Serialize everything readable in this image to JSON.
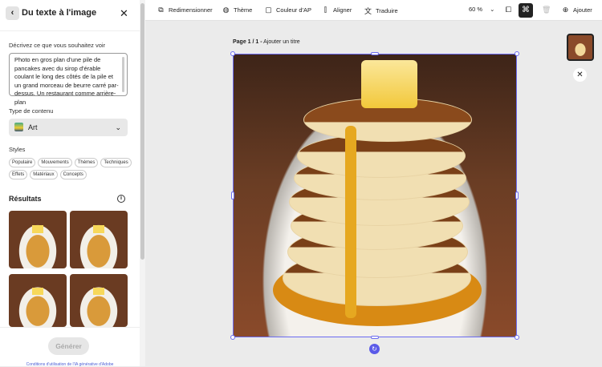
{
  "panel": {
    "title": "Du texte à l'image",
    "prompt_label": "Décrivez ce que vous souhaitez voir",
    "prompt_value": "Photo en gros plan d'une pile de pancakes avec du sirop d'érable coulant le long des côtés de la pile et un grand morceau de beurre carré par-dessus. Un restaurant comme arrière-plan",
    "content_type_label": "Type de contenu",
    "content_type_value": "Art",
    "styles_label": "Styles",
    "styles": [
      "Populaire",
      "Mouvements",
      "Thèmes",
      "Techniques",
      "Effets",
      "Matériaux",
      "Concepts"
    ],
    "results_label": "Résultats",
    "generate_label": "Générer",
    "terms_link": "Conditions d'utilisation de l'IA générative d'Adobe"
  },
  "toolbar": {
    "resize": "Redimensionner",
    "theme": "Thème",
    "bg_color": "Couleur d'AP",
    "align": "Aligner",
    "translate": "Traduire",
    "zoom": "60 %",
    "add": "Ajouter"
  },
  "canvas": {
    "page_label": "Page 1 / 1 -",
    "page_title_placeholder": "Ajouter un titre"
  },
  "colors": {
    "selection": "#6b6bf0",
    "link": "#4b5fd6"
  }
}
